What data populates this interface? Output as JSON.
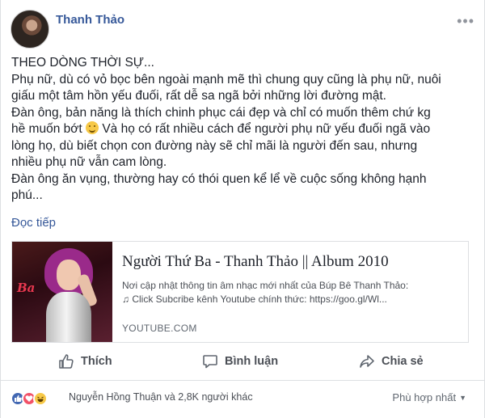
{
  "post": {
    "author": "Thanh Thảo",
    "body_lines": [
      "THEO DÒNG THỜI SỰ...",
      "Phụ nữ, dù có vỏ bọc bên ngoài mạnh mẽ thì chung quy cũng là phụ nữ, nuôi",
      "giấu một tâm hồn yếu đuối, rất dễ sa ngã bởi những lời đường mật.",
      "Đàn ông, bản năng là thích chinh phục cái đẹp và chỉ có muốn thêm chứ kg"
    ],
    "line_with_emoji_before": "hề muốn bớt",
    "line_with_emoji_after": " Và họ có rất nhiều cách để người phụ nữ yếu đuối ngã vào",
    "body_lines_after": [
      "lòng họ, dù biết chọn con đường này sẽ chỉ mãi là người đến sau, nhưng",
      "nhiều phụ nữ vẫn cam lòng.",
      "Đàn ông ăn vụng, thường hay có thói quen kể lể về cuộc sống không hạnh",
      "phú..."
    ],
    "see_more": "Đọc tiếp",
    "emoji_icon": "smile-emoji-icon"
  },
  "link_card": {
    "thumb_logo": "Ba",
    "title": "Người Thứ Ba - Thanh Thảo || Album 2010",
    "desc_line1": "Nơi cập nhật thông tin âm nhạc mới nhất của Búp Bê Thanh Thảo:",
    "desc_line2": "♫ Click Subcribe kênh Youtube chính thức: https://goo.gl/Wl...",
    "domain": "YOUTUBE.COM"
  },
  "actions": {
    "like": "Thích",
    "comment": "Bình luận",
    "share": "Chia sẻ"
  },
  "reactions": {
    "summary": "Nguyễn Hồng Thuận và 2,8K người khác",
    "icons": [
      "like-icon",
      "love-icon",
      "haha-icon"
    ],
    "colors": {
      "like": "#4267b2",
      "love": "#f25268",
      "haha": "#f7c948"
    }
  },
  "sort": {
    "label": "Phù hợp nhất"
  },
  "colors": {
    "link": "#365899",
    "text": "#1d2129",
    "muted": "#4b4f56"
  }
}
